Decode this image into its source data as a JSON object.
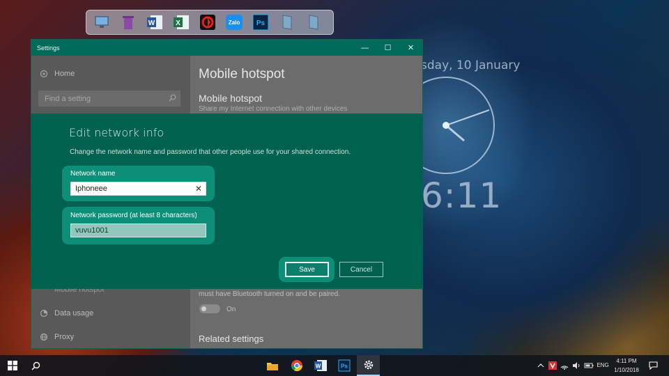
{
  "dock": {
    "items": [
      {
        "icon": "monitor-icon"
      },
      {
        "icon": "recycle-bin-icon"
      },
      {
        "icon": "word-icon",
        "label": "W"
      },
      {
        "icon": "excel-icon",
        "label": "X"
      },
      {
        "icon": "garena-icon"
      },
      {
        "icon": "zalo-icon",
        "label": "Zalo"
      },
      {
        "icon": "photoshop-icon",
        "label": "Ps"
      },
      {
        "icon": "book-icon"
      },
      {
        "icon": "book-icon"
      }
    ]
  },
  "clock": {
    "date": "sday, 10 January",
    "time": "6:11"
  },
  "settings": {
    "title": "Settings",
    "controls": {
      "minimize": "—",
      "maximize": "☐",
      "close": "✕"
    },
    "sidebar": {
      "home": "Home",
      "search_placeholder": "Find a setting",
      "mobile_hotspot": "Mobile hotspot",
      "data_usage": "Data usage",
      "proxy": "Proxy"
    },
    "content": {
      "title": "Mobile hotspot",
      "section": "Mobile hotspot",
      "subtitle": "Share my Internet connection with other devices",
      "bluetooth_text": "must have Bluetooth turned on and be paired.",
      "toggle_label": "On",
      "related": "Related settings"
    }
  },
  "dialog": {
    "title": "Edit network info",
    "description": "Change the network name and password that other people use for your shared connection.",
    "network_name_label": "Network name",
    "network_name_value": "Iphoneee",
    "network_password_label": "Network password (at least 8 characters)",
    "network_password_value": "vuvu1001",
    "save_label": "Save",
    "cancel_label": "Cancel"
  },
  "taskbar": {
    "tray": {
      "language": "ENG",
      "time": "4:11 PM",
      "date": "1/10/2018"
    },
    "apps": [
      {
        "icon": "file-explorer-icon"
      },
      {
        "icon": "chrome-icon"
      },
      {
        "icon": "word-icon",
        "label": "W"
      },
      {
        "icon": "photoshop-icon",
        "label": "Ps"
      },
      {
        "icon": "settings-icon"
      }
    ]
  },
  "colors": {
    "accent": "#00614f",
    "accent_light": "#0d8e78",
    "titlebar": "#006a5a"
  }
}
